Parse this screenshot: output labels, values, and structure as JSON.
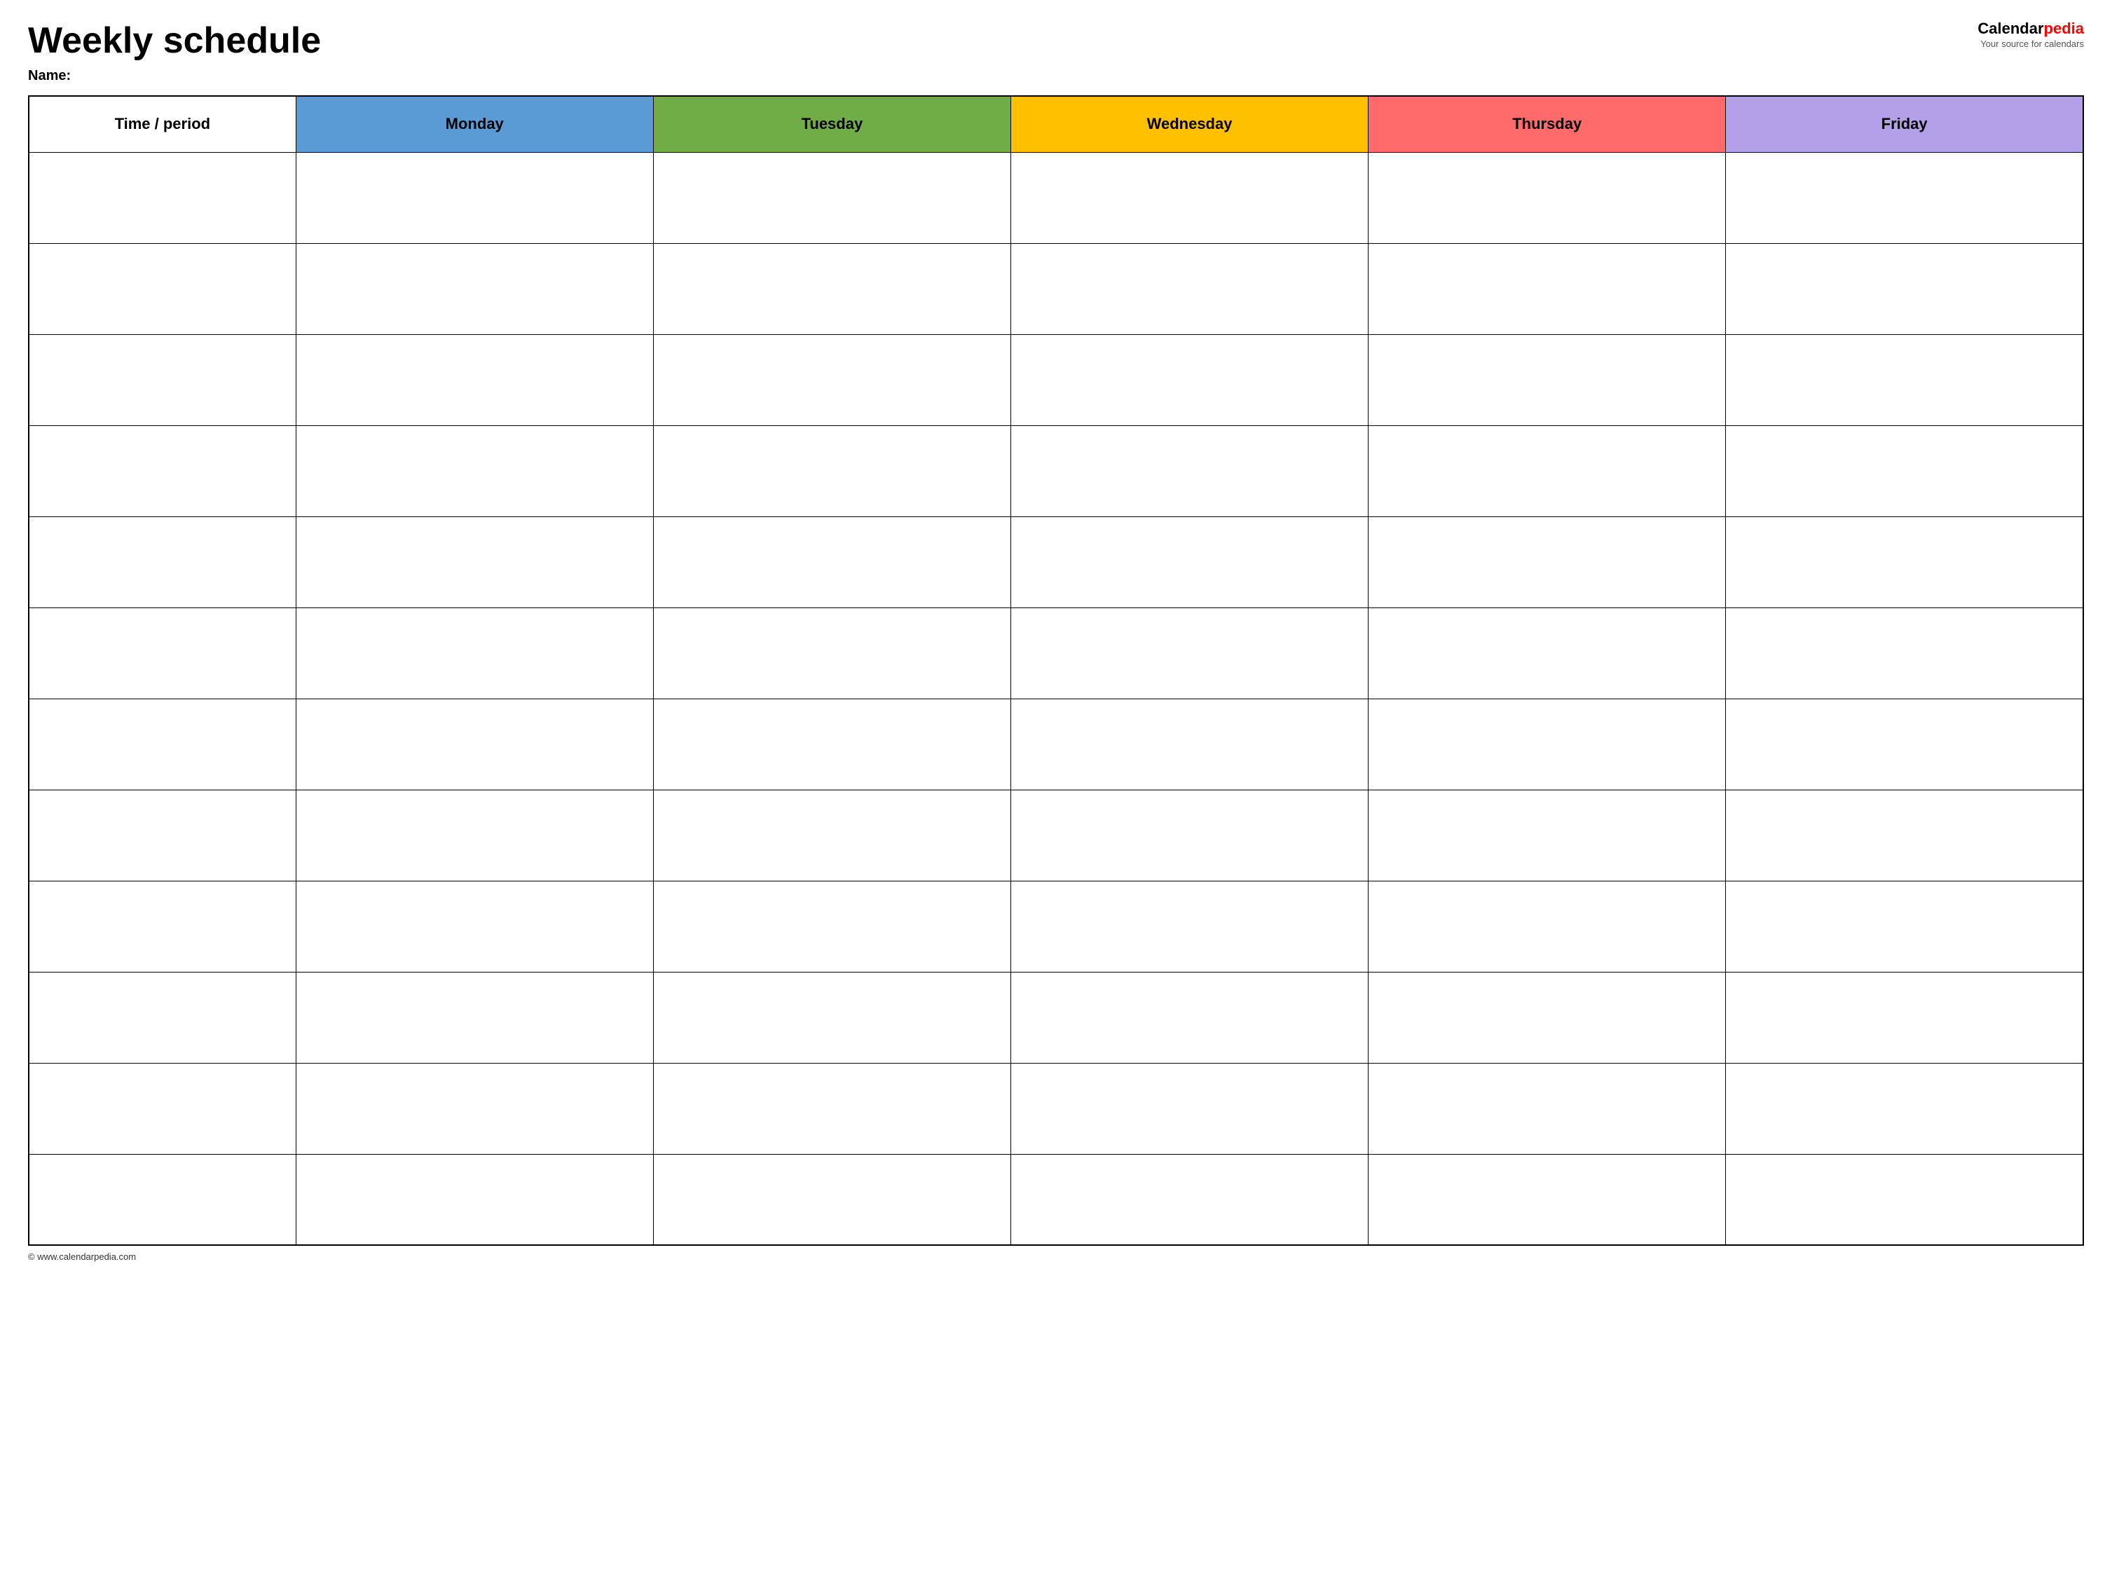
{
  "header": {
    "title": "Weekly schedule",
    "name_label": "Name:",
    "logo_calendar": "Calendar",
    "logo_pedia": "pedia",
    "logo_tagline": "Your source for calendars"
  },
  "table": {
    "columns": [
      {
        "key": "time",
        "label": "Time / period",
        "color": "#ffffff",
        "text_color": "#000000"
      },
      {
        "key": "monday",
        "label": "Monday",
        "color": "#5b9bd5",
        "text_color": "#000000"
      },
      {
        "key": "tuesday",
        "label": "Tuesday",
        "color": "#70ad47",
        "text_color": "#000000"
      },
      {
        "key": "wednesday",
        "label": "Wednesday",
        "color": "#ffc000",
        "text_color": "#000000"
      },
      {
        "key": "thursday",
        "label": "Thursday",
        "color": "#ff6b6b",
        "text_color": "#000000"
      },
      {
        "key": "friday",
        "label": "Friday",
        "color": "#b4a0e8",
        "text_color": "#000000"
      }
    ],
    "row_count": 12
  },
  "footer": {
    "url": "© www.calendarpedia.com"
  }
}
